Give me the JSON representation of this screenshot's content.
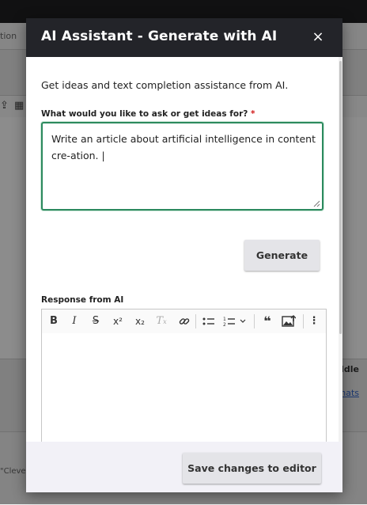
{
  "background": {
    "tab_text": "tion",
    "status_text": "Idle",
    "link_text": "mats",
    "footer_text": "\"Clevel"
  },
  "dialog": {
    "title": "AI Assistant - Generate with AI",
    "close_label": "×",
    "intro": "Get ideas and text completion assistance from AI.",
    "prompt": {
      "label": "What would you like to ask or get ideas for?",
      "required_marker": "*",
      "value": "Write an article about artificial intelligence in content cre-ation. |"
    },
    "generate_label": "Generate",
    "response": {
      "label": "Response from AI",
      "toolbar": [
        {
          "name": "bold",
          "glyph": "B"
        },
        {
          "name": "italic",
          "glyph": "I"
        },
        {
          "name": "strikethrough",
          "glyph": "S"
        },
        {
          "name": "superscript",
          "glyph": "x²"
        },
        {
          "name": "subscript",
          "glyph": "x₂"
        },
        {
          "name": "remove-format",
          "glyph": "Tx"
        },
        {
          "name": "link",
          "glyph": "link"
        },
        {
          "name": "bulleted-list",
          "glyph": "bullets"
        },
        {
          "name": "numbered-list",
          "glyph": "numbers"
        },
        {
          "name": "blockquote",
          "glyph": "❝"
        },
        {
          "name": "insert-image",
          "glyph": "image"
        },
        {
          "name": "more",
          "glyph": "⋮"
        }
      ],
      "value": ""
    },
    "save_label": "Save changes to editor"
  },
  "colors": {
    "header_bg": "#232429",
    "focus_border": "#2c8a5e",
    "required": "#d11a1a",
    "button_bg": "#e4e4e8",
    "footer_bg": "#f2f1f7"
  }
}
